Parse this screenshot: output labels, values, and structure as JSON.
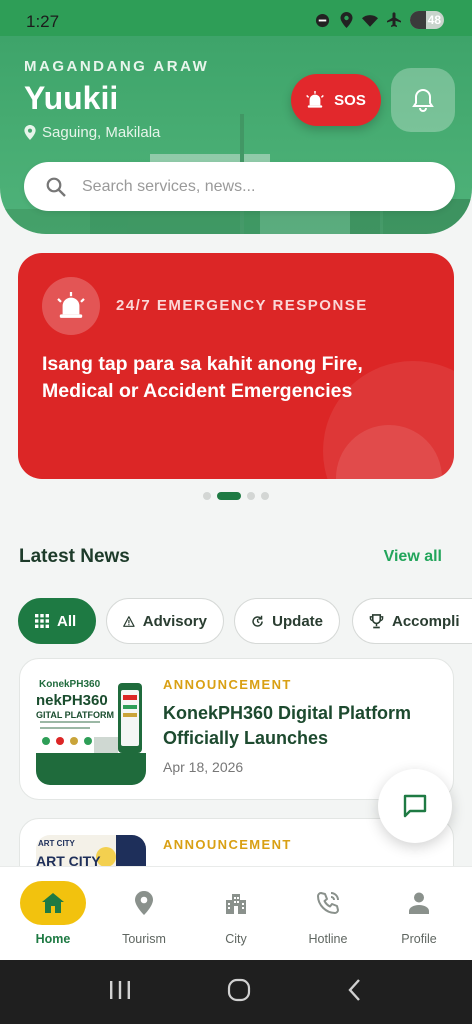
{
  "status_bar": {
    "time": "1:27",
    "battery": "48",
    "battery_level": 0.48
  },
  "header": {
    "greeting": "MAGANDANG ARAW",
    "username": "Yuukii",
    "location": "Saguing, Makilala",
    "sos_label": "SOS"
  },
  "search": {
    "placeholder": "Search services, news..."
  },
  "banner": {
    "kicker": "24/7 EMERGENCY RESPONSE",
    "text": "Isang tap para sa kahit anong Fire, Medical or Accident Emergencies",
    "slide_count": 4,
    "active_slide": 2
  },
  "news": {
    "title": "Latest News",
    "view_all": "View all",
    "filters": [
      {
        "label": "All",
        "icon": "grid-icon",
        "active": true
      },
      {
        "label": "Advisory",
        "icon": "warning-icon",
        "active": false
      },
      {
        "label": "Update",
        "icon": "refresh-icon",
        "active": false
      },
      {
        "label": "Accompli",
        "icon": "trophy-icon",
        "active": false
      }
    ],
    "items": [
      {
        "category": "ANNOUNCEMENT",
        "headline": "KonekPH360 Digital Platform Officially Launches",
        "date": "Apr 18, 2026",
        "thumb_lines": [
          "KonekPH360",
          "nekPH360",
          "GITAL PLATFORM"
        ]
      },
      {
        "category": "ANNOUNCEMENT",
        "headline": "",
        "date": "",
        "thumb_lines": [
          "ART CITY",
          "ART CITY"
        ]
      }
    ]
  },
  "bottom_nav": [
    {
      "label": "Home",
      "icon": "home-icon",
      "active": true
    },
    {
      "label": "Tourism",
      "icon": "location-pin-icon",
      "active": false
    },
    {
      "label": "City",
      "icon": "city-icon",
      "active": false
    },
    {
      "label": "Hotline",
      "icon": "phone-icon",
      "active": false
    },
    {
      "label": "Profile",
      "icon": "person-icon",
      "active": false
    }
  ],
  "colors": {
    "primary_green": "#1e7a43",
    "accent_yellow": "#f2c20e",
    "emergency_red": "#dc2626",
    "category_gold": "#d9a014"
  }
}
